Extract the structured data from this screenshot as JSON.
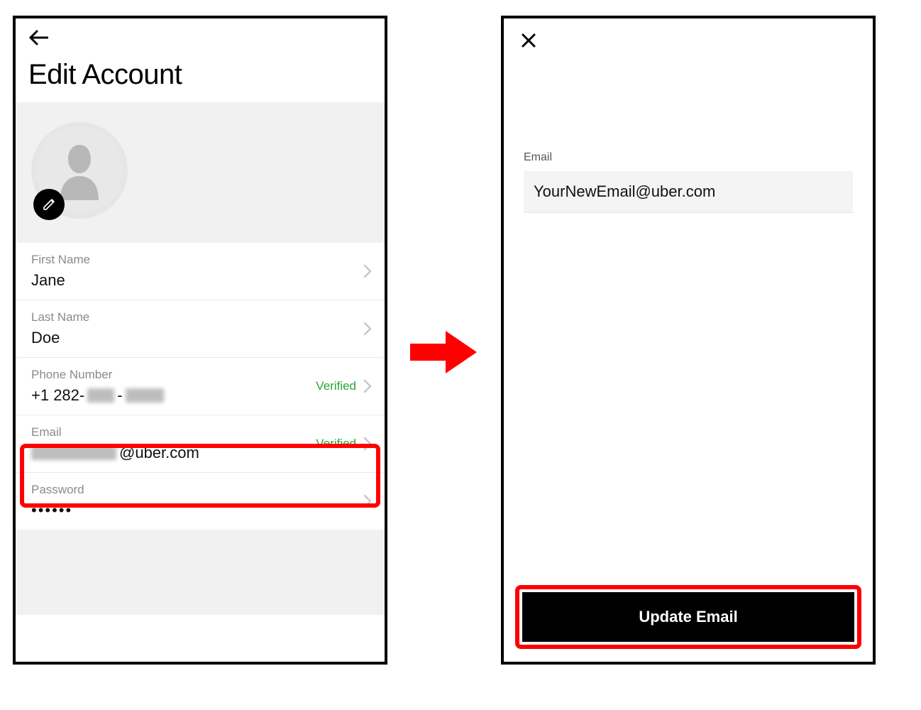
{
  "colors": {
    "highlight": "#ff0000",
    "verified": "#2aa530"
  },
  "left": {
    "title": "Edit Account",
    "fields": {
      "first_name": {
        "label": "First Name",
        "value": "Jane"
      },
      "last_name": {
        "label": "Last Name",
        "value": "Doe"
      },
      "phone": {
        "label": "Phone Number",
        "value_prefix": "+1 282-",
        "verified": "Verified"
      },
      "email": {
        "label": "Email",
        "value_suffix": "@uber.com",
        "verified": "Verified"
      },
      "password": {
        "label": "Password",
        "value": "••••••"
      }
    }
  },
  "right": {
    "email_label": "Email",
    "email_value": "YourNewEmail@uber.com",
    "button": "Update Email"
  }
}
